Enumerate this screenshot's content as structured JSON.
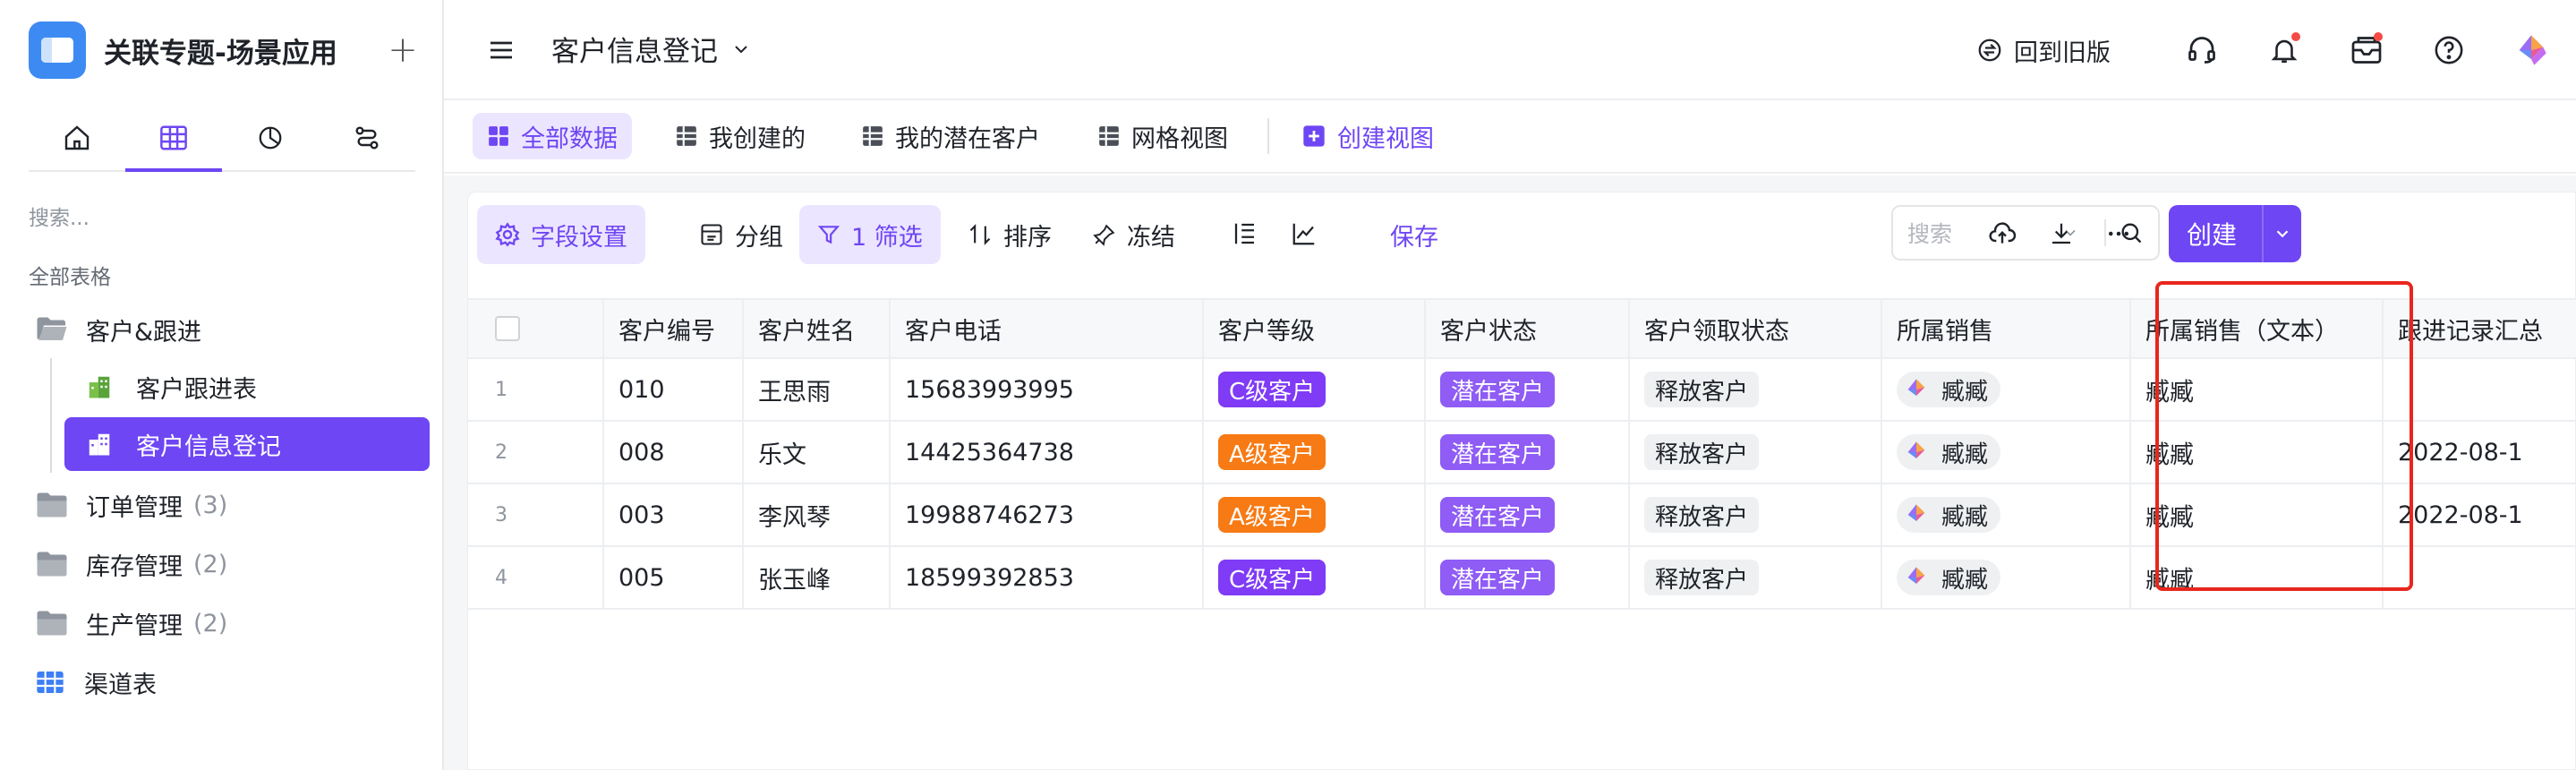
{
  "app": {
    "title": "关联专题-场景应用"
  },
  "sidebar": {
    "search_placeholder": "搜索...",
    "section_label": "全部表格",
    "items": [
      {
        "label": "客户&跟进",
        "count": ""
      },
      {
        "label": "客户跟进表",
        "count": ""
      },
      {
        "label": "客户信息登记",
        "count": ""
      },
      {
        "label": "订单管理",
        "count": "(3)"
      },
      {
        "label": "库存管理",
        "count": "(2)"
      },
      {
        "label": "生产管理",
        "count": "(2)"
      },
      {
        "label": "渠道表",
        "count": ""
      }
    ]
  },
  "header": {
    "page_title": "客户信息登记",
    "old_version": "回到旧版"
  },
  "views": {
    "tabs": [
      "全部数据",
      "我创建的",
      "我的潜在客户",
      "网格视图"
    ],
    "create_view": "创建视图"
  },
  "toolbar": {
    "field_settings": "字段设置",
    "group": "分组",
    "filter": "1 筛选",
    "sort": "排序",
    "freeze": "冻结",
    "save": "保存",
    "search_placeholder": "搜索",
    "create": "创建"
  },
  "table": {
    "columns": [
      "客户编号",
      "客户姓名",
      "客户电话",
      "客户等级",
      "客户状态",
      "客户领取状态",
      "所属销售",
      "所属销售（文本）",
      "跟进记录汇总"
    ],
    "rows": [
      {
        "idx": "1",
        "id": "010",
        "name": "王思雨",
        "phone": "15683993995",
        "level": "C级客户",
        "level_type": "c",
        "status": "潜在客户",
        "claim": "释放客户",
        "sales": "臧臧",
        "sales_text": "臧臧",
        "followup": ""
      },
      {
        "idx": "2",
        "id": "008",
        "name": "乐文",
        "phone": "14425364738",
        "level": "A级客户",
        "level_type": "a",
        "status": "潜在客户",
        "claim": "释放客户",
        "sales": "臧臧",
        "sales_text": "臧臧",
        "followup": "2022-08-1"
      },
      {
        "idx": "3",
        "id": "003",
        "name": "李风琴",
        "phone": "19988746273",
        "level": "A级客户",
        "level_type": "a",
        "status": "潜在客户",
        "claim": "释放客户",
        "sales": "臧臧",
        "sales_text": "臧臧",
        "followup": "2022-08-1"
      },
      {
        "idx": "4",
        "id": "005",
        "name": "张玉峰",
        "phone": "18599392853",
        "level": "C级客户",
        "level_type": "c",
        "status": "潜在客户",
        "claim": "释放客户",
        "sales": "臧臧",
        "sales_text": "臧臧",
        "followup": ""
      }
    ]
  },
  "colors": {
    "accent": "#6e46f4",
    "level_c": "#7f3bf5",
    "level_a": "#f77a14",
    "highlight_box": "#e8261d"
  }
}
